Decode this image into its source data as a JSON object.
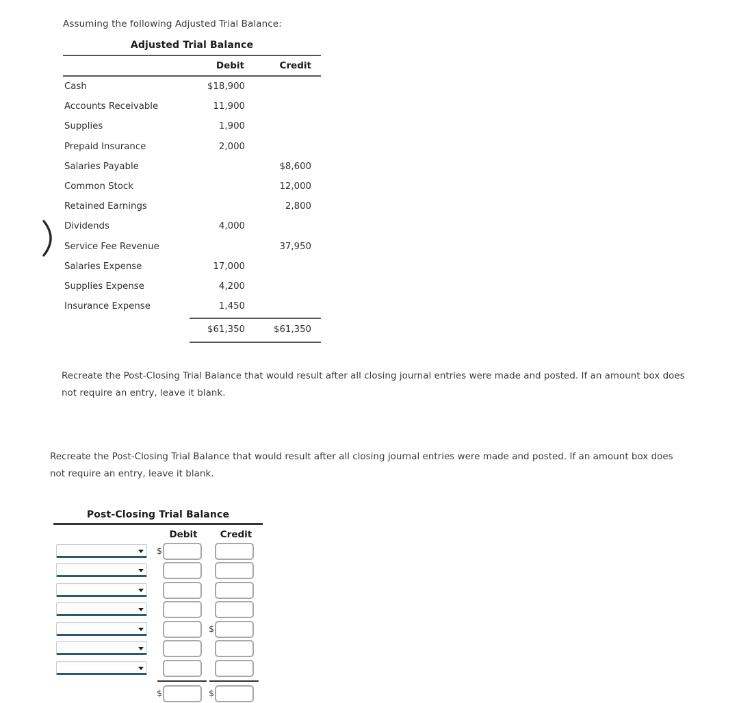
{
  "intro": "Assuming the following Adjusted Trial Balance:",
  "adjusted_trial_balance": {
    "title": "Adjusted Trial Balance",
    "columns": [
      "",
      "Debit",
      "Credit"
    ],
    "rows": [
      {
        "account": "Cash",
        "debit": "$18,900",
        "credit": ""
      },
      {
        "account": "Accounts Receivable",
        "debit": "11,900",
        "credit": ""
      },
      {
        "account": "Supplies",
        "debit": "1,900",
        "credit": ""
      },
      {
        "account": "Prepaid Insurance",
        "debit": "2,000",
        "credit": ""
      },
      {
        "account": "Salaries Payable",
        "debit": "",
        "credit": "$8,600"
      },
      {
        "account": "Common Stock",
        "debit": "",
        "credit": "12,000"
      },
      {
        "account": "Retained Earnings",
        "debit": "",
        "credit": "2,800"
      },
      {
        "account": "Dividends",
        "debit": "4,000",
        "credit": ""
      },
      {
        "account": "Service Fee Revenue",
        "debit": "",
        "credit": "37,950"
      },
      {
        "account": "Salaries Expense",
        "debit": "17,000",
        "credit": ""
      },
      {
        "account": "Supplies Expense",
        "debit": "4,200",
        "credit": ""
      },
      {
        "account": "Insurance Expense",
        "debit": "1,450",
        "credit": ""
      }
    ],
    "totals": {
      "debit": "$61,350",
      "credit": "$61,350"
    }
  },
  "instructions": {
    "first": "Recreate the Post-Closing Trial Balance that would result after all closing journal entries were made and posted. If an amount box does not require an entry, leave it blank.",
    "second": "Recreate the Post-Closing Trial Balance that would result after all closing journal entries were made and posted. If an amount box does not require an entry, leave it blank."
  },
  "post_closing_trial_balance": {
    "title": "Post-Closing Trial Balance",
    "debit_header": "Debit",
    "credit_header": "Credit",
    "currency_symbol": "$",
    "rows": [
      {
        "account_value": "",
        "debit_value": "",
        "credit_value": "",
        "debit_dollar": true,
        "credit_dollar": false
      },
      {
        "account_value": "",
        "debit_value": "",
        "credit_value": "",
        "debit_dollar": false,
        "credit_dollar": false
      },
      {
        "account_value": "",
        "debit_value": "",
        "credit_value": "",
        "debit_dollar": false,
        "credit_dollar": false
      },
      {
        "account_value": "",
        "debit_value": "",
        "credit_value": "",
        "debit_dollar": false,
        "credit_dollar": false
      },
      {
        "account_value": "",
        "debit_value": "",
        "credit_value": "",
        "debit_dollar": false,
        "credit_dollar": true
      },
      {
        "account_value": "",
        "debit_value": "",
        "credit_value": "",
        "debit_dollar": false,
        "credit_dollar": false
      },
      {
        "account_value": "",
        "debit_value": "",
        "credit_value": "",
        "debit_dollar": false,
        "credit_dollar": false
      }
    ],
    "total_row": {
      "debit_value": "",
      "credit_value": "",
      "debit_dollar": true,
      "credit_dollar": true
    }
  },
  "colors": {
    "select_underline": "#2c5871",
    "input_border": "#a7a7a7",
    "rule": "#555555",
    "text": "#2f2f2f"
  }
}
